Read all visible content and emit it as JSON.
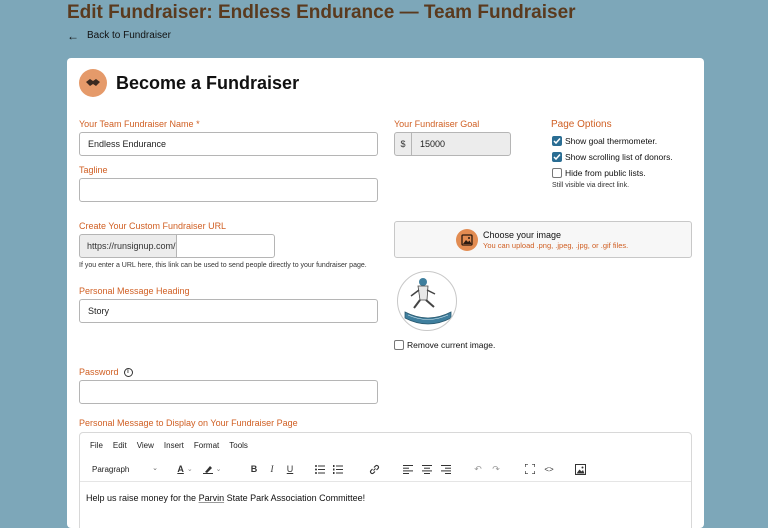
{
  "page": {
    "title": "Edit Fundraiser: Endless Endurance — Team Fundraiser",
    "back_label": "Back to Fundraiser"
  },
  "card": {
    "title": "Become a Fundraiser"
  },
  "form": {
    "team_name_label": "Your Team Fundraiser Name",
    "team_name_required": "*",
    "team_name_value": "Endless Endurance",
    "tagline_label": "Tagline",
    "tagline_value": "",
    "url_label": "Create Your Custom Fundraiser URL",
    "url_prefix": "https://runsignup.com/",
    "url_value": "",
    "url_help": "If you enter a URL here, this link can be used to send people directly to your fundraiser page.",
    "heading_label": "Personal Message Heading",
    "heading_value": "Story",
    "password_label": "Password",
    "password_value": "",
    "message_label": "Personal Message to Display on Your Fundraiser Page",
    "goal_label": "Your Fundraiser Goal",
    "goal_currency": "$",
    "goal_value": "15000"
  },
  "page_options": {
    "title": "Page Options",
    "show_thermometer": {
      "label": "Show goal thermometer.",
      "checked": true
    },
    "show_donors": {
      "label": "Show scrolling list of donors.",
      "checked": true
    },
    "hide_public": {
      "label": "Hide from public lists.",
      "checked": false
    },
    "hide_note": "Still visible via direct link."
  },
  "image": {
    "choose_label": "Choose your image",
    "upload_hint": "You can upload .png, .jpeg, .jpg, or .gif files.",
    "remove_label": "Remove current image.",
    "remove_checked": false
  },
  "editor": {
    "menu": [
      "File",
      "Edit",
      "View",
      "Insert",
      "Format",
      "Tools"
    ],
    "block_format": "Paragraph",
    "content_before": "Help us raise money for the ",
    "content_link": "Parvin",
    "content_after": " State Park Association Committee!"
  },
  "colors": {
    "background": "#7da7b9",
    "accent": "#d05f23",
    "title": "#5a3a1e",
    "checkbox": "#2a6d93"
  }
}
